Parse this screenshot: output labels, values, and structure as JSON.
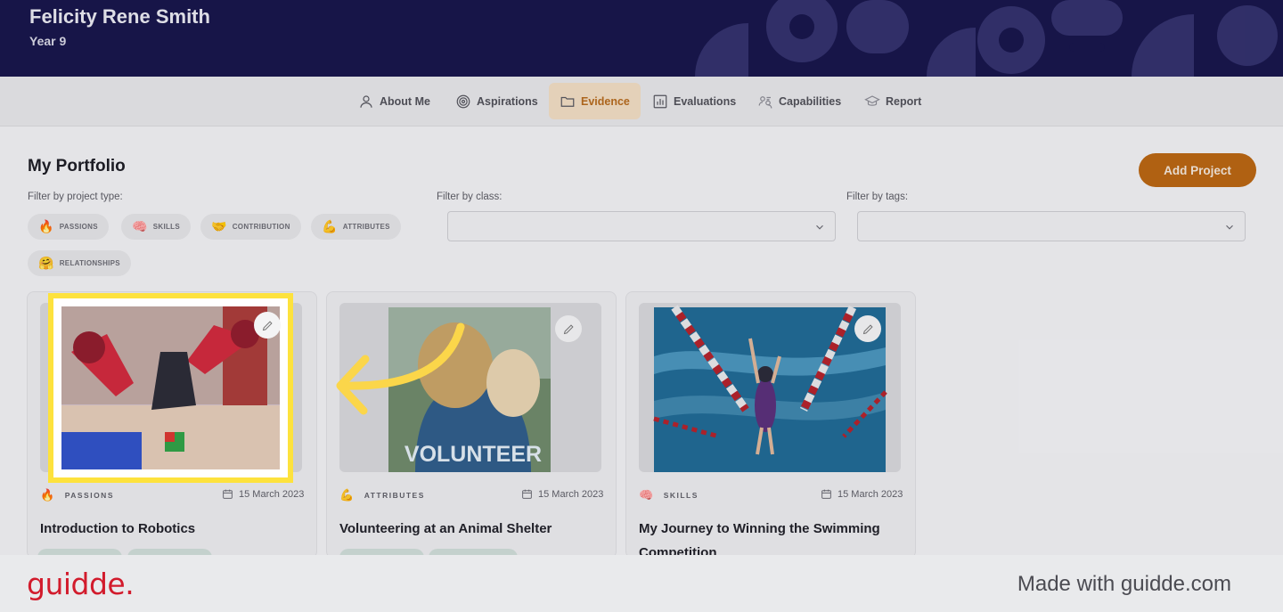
{
  "header": {
    "name": "Felicity Rene Smith",
    "year": "Year 9"
  },
  "tabs": [
    {
      "label": "About Me",
      "icon": "person-icon"
    },
    {
      "label": "Aspirations",
      "icon": "target-icon"
    },
    {
      "label": "Evidence",
      "icon": "folder-icon",
      "active": true
    },
    {
      "label": "Evaluations",
      "icon": "bar-chart-icon"
    },
    {
      "label": "Capabilities",
      "icon": "people-icon"
    },
    {
      "label": "Report",
      "icon": "graduation-cap-icon"
    }
  ],
  "portfolio": {
    "title": "My Portfolio",
    "add_button": "Add Project",
    "filter_type_label": "Filter by project type:",
    "filter_class_label": "Filter by class:",
    "filter_tags_label": "Filter by tags:",
    "chips": [
      {
        "label": "PASSIONS",
        "emoji": "🔥"
      },
      {
        "label": "SKILLS",
        "emoji": "🧠"
      },
      {
        "label": "CONTRIBUTION",
        "emoji": "🤝"
      },
      {
        "label": "ATTRIBUTES",
        "emoji": "💪"
      },
      {
        "label": "RELATIONSHIPS",
        "emoji": "🤗"
      }
    ]
  },
  "cards": [
    {
      "type": "PASSIONS",
      "emoji": "🔥",
      "date": "15 March 2023",
      "title": "Introduction to Robotics"
    },
    {
      "type": "ATTRIBUTES",
      "emoji": "💪",
      "date": "15 March 2023",
      "title": "Volunteering at an Animal Shelter",
      "image_text": "VOLUNTEER"
    },
    {
      "type": "SKILLS",
      "emoji": "🧠",
      "date": "15 March 2023",
      "title": "My Journey to Winning the Swimming Competition"
    }
  ],
  "footer": {
    "brand": "guidde.",
    "made_with": "Made with guidde.com"
  },
  "colors": {
    "header_bg": "#17154a",
    "accent": "#b96510",
    "highlight": "#fde23d",
    "brand_red": "#d21b2c"
  }
}
